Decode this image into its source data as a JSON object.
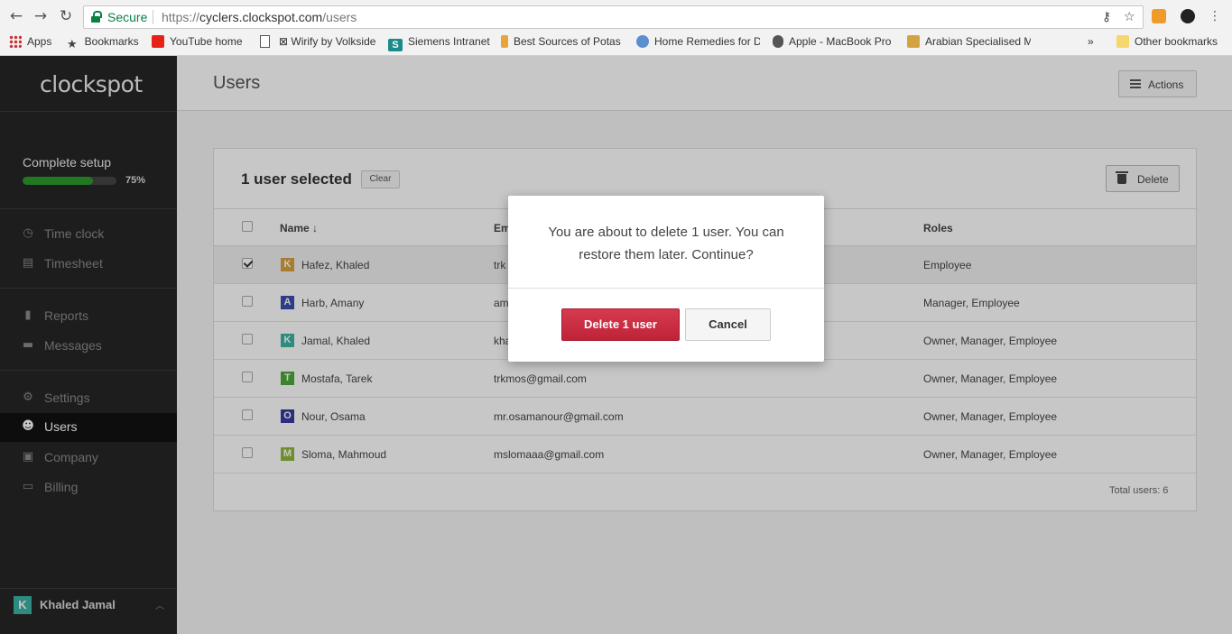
{
  "browser": {
    "secure_label": "Secure",
    "url_prefix": "https://",
    "url_host": "cyclers.clockspot.com",
    "url_path": "/users",
    "bookmarks": [
      {
        "label": "Apps"
      },
      {
        "label": "Bookmarks"
      },
      {
        "label": "YouTube home"
      },
      {
        "label": ""
      },
      {
        "label": "⊠ Wirify by Volkside"
      },
      {
        "label": "Siemens Intranet"
      },
      {
        "label": "Best Sources of Potas"
      },
      {
        "label": "Home Remedies for D"
      },
      {
        "label": "Apple - MacBook Pro"
      },
      {
        "label": "Arabian Specialised M"
      },
      {
        "label": "»"
      },
      {
        "label": "Other bookmarks"
      }
    ]
  },
  "sidebar": {
    "logo": "clockspot",
    "setup_label": "Complete setup",
    "setup_progress": 0.75,
    "setup_pct": "75%",
    "items": [
      {
        "label": "Time clock",
        "icon": "clock-icon"
      },
      {
        "label": "Timesheet",
        "icon": "clipboard-icon"
      },
      {
        "label": "Reports",
        "icon": "bar-chart-icon"
      },
      {
        "label": "Messages",
        "icon": "message-icon"
      },
      {
        "label": "Settings",
        "icon": "gears-icon"
      },
      {
        "label": "Users",
        "icon": "users-icon"
      },
      {
        "label": "Company",
        "icon": "briefcase-icon"
      },
      {
        "label": "Billing",
        "icon": "billing-icon"
      }
    ],
    "user": {
      "initial": "K",
      "name": "Khaled Jamal"
    }
  },
  "main": {
    "title": "Users",
    "actions_label": "Actions",
    "selection_text": "1 user selected",
    "clear_label": "Clear",
    "delete_label": "Delete",
    "columns": {
      "name": "Name ↓",
      "email": "Email",
      "roles": "Roles"
    },
    "rows": [
      {
        "initial": "K",
        "color": "#d8a03c",
        "name": "Hafez, Khaled",
        "email": "trk",
        "roles": "Employee"
      },
      {
        "initial": "A",
        "color": "#3a4fb0",
        "name": "Harb, Amany",
        "email": "am",
        "roles": "Manager, Employee"
      },
      {
        "initial": "K",
        "color": "#3bb3a5",
        "name": "Jamal, Khaled",
        "email": "kha",
        "roles": "Owner, Manager, Employee"
      },
      {
        "initial": "T",
        "color": "#4caa3c",
        "name": "Mostafa, Tarek",
        "email": "trkmos@gmail.com",
        "roles": "Owner, Manager, Employee"
      },
      {
        "initial": "O",
        "color": "#3a3aa0",
        "name": "Nour, Osama",
        "email": "mr.osamanour@gmail.com",
        "roles": "Owner, Manager, Employee"
      },
      {
        "initial": "M",
        "color": "#8fb83c",
        "name": "Sloma, Mahmoud",
        "email": "mslomaaa@gmail.com",
        "roles": "Owner, Manager, Employee"
      }
    ],
    "total": "Total users: 6"
  },
  "modal": {
    "message": "You are about to delete 1 user. You can restore them later. Continue?",
    "confirm_label": "Delete 1 user",
    "cancel_label": "Cancel"
  },
  "colors": {
    "sidebar_bg": "#262626",
    "progress": "#2c9a2c",
    "danger": "#c9302c",
    "secure_green": "#0b8043"
  }
}
